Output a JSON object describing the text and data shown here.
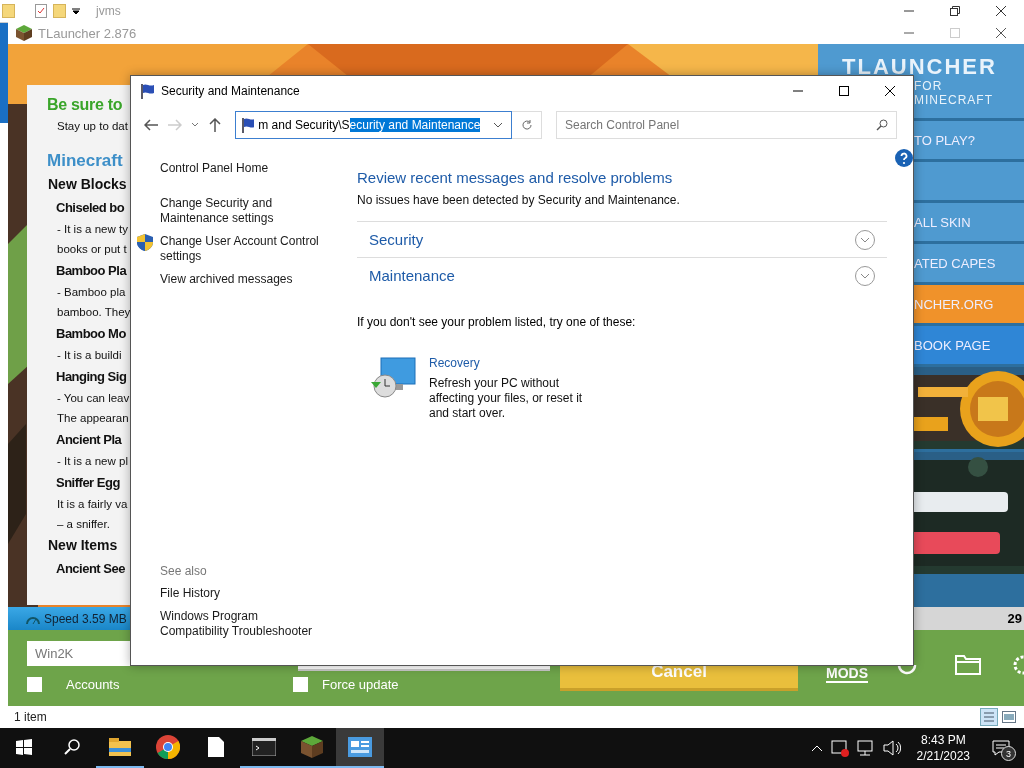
{
  "explorer_window": {
    "title": "jvms",
    "status_bar": "1 item"
  },
  "launcher": {
    "title": "TLauncher 2.876",
    "news": [
      {
        "kind": "headline",
        "text": "Be sure to"
      },
      {
        "kind": "body",
        "text": "Stay up to dat"
      },
      {
        "kind": "title",
        "text": "Minecraft"
      },
      {
        "kind": "section",
        "text": "New Blocks"
      },
      {
        "kind": "subhead",
        "text": "Chiseled bo"
      },
      {
        "kind": "body",
        "text": "- It is a new ty"
      },
      {
        "kind": "body",
        "text": "books or put t"
      },
      {
        "kind": "subhead",
        "text": "Bamboo Pla"
      },
      {
        "kind": "body",
        "text": "- Bamboo pla"
      },
      {
        "kind": "body",
        "text": "bamboo. They"
      },
      {
        "kind": "subhead",
        "text": "Bamboo Mo"
      },
      {
        "kind": "body",
        "text": "- It is a buildi"
      },
      {
        "kind": "subhead",
        "text": "Hanging Sig"
      },
      {
        "kind": "body",
        "text": "- You can leav"
      },
      {
        "kind": "body",
        "text": "The appearan"
      },
      {
        "kind": "subhead",
        "text": "Ancient Pla"
      },
      {
        "kind": "body",
        "text": "- It is a new pl"
      },
      {
        "kind": "subhead",
        "text": "Sniffer Egg"
      },
      {
        "kind": "body",
        "text": "It is a fairly va"
      },
      {
        "kind": "body",
        "text": "– a sniffer."
      },
      {
        "kind": "section",
        "text": "New Items"
      },
      {
        "kind": "subhead",
        "text": "Ancient See"
      }
    ],
    "sidebar": {
      "logo": "TLAUNCHER",
      "tagline": "FOR MINECRAFT",
      "items": [
        {
          "kind": "menu",
          "text": "TO PLAY?",
          "color": "#4f9ad0"
        },
        {
          "kind": "blank",
          "color": "#4f9ad0"
        },
        {
          "kind": "menu",
          "text": "ALL SKIN",
          "color": "#4f9ad0"
        },
        {
          "kind": "menu",
          "text": "ATED CAPES",
          "color": "#4f9ad0"
        },
        {
          "kind": "menu",
          "text": "NCHER.ORG",
          "color": "#f0922a"
        },
        {
          "kind": "menu",
          "text": "BOOK PAGE",
          "color": "#2f86d6"
        },
        {
          "kind": "picture"
        },
        {
          "kind": "picture"
        }
      ]
    },
    "speed": "Speed 3.59 MB",
    "counter": "29",
    "account_field": {
      "value": "Win2K"
    },
    "accounts": {
      "label": "Accounts",
      "checked": false
    },
    "force_update": {
      "label": "Force update",
      "checked": false
    },
    "play_button": "Cancel",
    "mods_logo": "MODS"
  },
  "dialog": {
    "title": "Security and Maintenance",
    "address": {
      "text": "m and Security\\S",
      "selected_text": "ecurity and Maintenance"
    },
    "search": {
      "placeholder": "Search Control Panel"
    },
    "nav_links": [
      {
        "kind": "link",
        "text": "Control Panel Home"
      },
      {
        "kind": "link",
        "text": "Change Security and Maintenance settings"
      },
      {
        "kind": "shield",
        "text": "Change User Account Control settings"
      },
      {
        "kind": "link",
        "text": "View archived messages"
      }
    ],
    "see_also": {
      "heading": "See also",
      "links": [
        "File History",
        "Windows Program Compatibility Troubleshooter"
      ]
    },
    "heading": "Review recent messages and resolve problems",
    "status": "No issues have been detected by Security and Maintenance.",
    "sections": [
      {
        "title": "Security",
        "expanded": false
      },
      {
        "title": "Maintenance",
        "expanded": false
      }
    ],
    "hint": "If you don't see your problem listed, try one of these:",
    "recovery": {
      "title": "Recovery",
      "description": "Refresh your PC without affecting your files, or reset it and start over."
    }
  },
  "taskbar": {
    "apps": [
      {
        "kind": "explorer",
        "running": true,
        "selected": false
      },
      {
        "kind": "chrome",
        "running": false,
        "selected": false
      },
      {
        "kind": "file",
        "running": false,
        "selected": false
      },
      {
        "kind": "terminal",
        "running": true,
        "selected": false
      },
      {
        "kind": "minecraft",
        "running": true,
        "selected": false
      },
      {
        "kind": "control-panel",
        "running": true,
        "selected": true
      }
    ],
    "time": "8:43 PM",
    "date": "2/21/2023",
    "notifications": "3"
  }
}
